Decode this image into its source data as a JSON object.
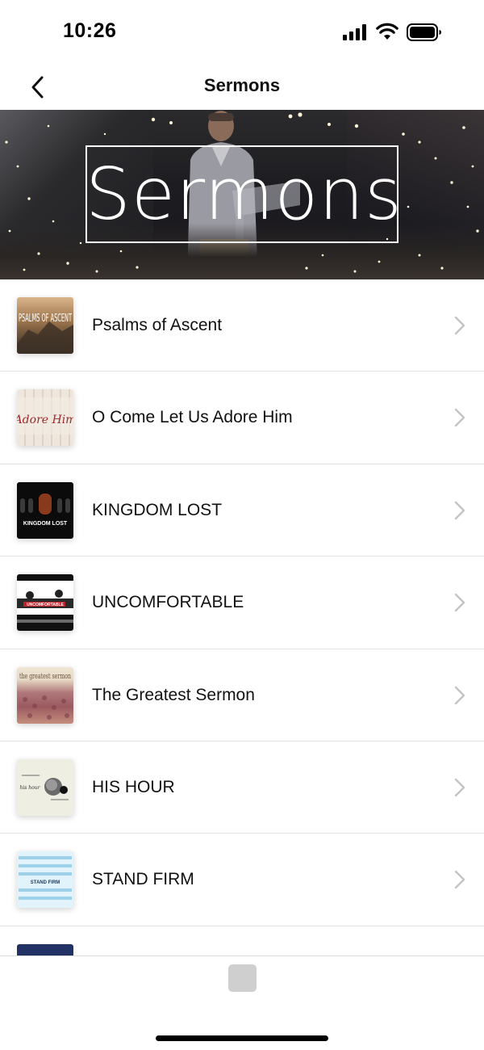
{
  "status_bar": {
    "time": "10:26"
  },
  "nav": {
    "title": "Sermons"
  },
  "hero": {
    "title": "Sermons"
  },
  "sermons": [
    {
      "title": "Psalms of Ascent",
      "thumb_text": "PSALMS OF ASCENT"
    },
    {
      "title": "O Come Let Us Adore Him",
      "thumb_text": "Adore Him"
    },
    {
      "title": "KINGDOM LOST",
      "thumb_text": "KINGDOM LOST"
    },
    {
      "title": "UNCOMFORTABLE",
      "thumb_text": "UNCOMFORTABLE"
    },
    {
      "title": "The Greatest Sermon",
      "thumb_text": "the greatest sermon"
    },
    {
      "title": "HIS HOUR",
      "thumb_text": "his hour"
    },
    {
      "title": "STAND FIRM",
      "thumb_text": "STAND FIRM"
    }
  ],
  "colors": {
    "divider": "#e2e2e2",
    "chevron": "#c4c4c6",
    "text": "#111111"
  }
}
